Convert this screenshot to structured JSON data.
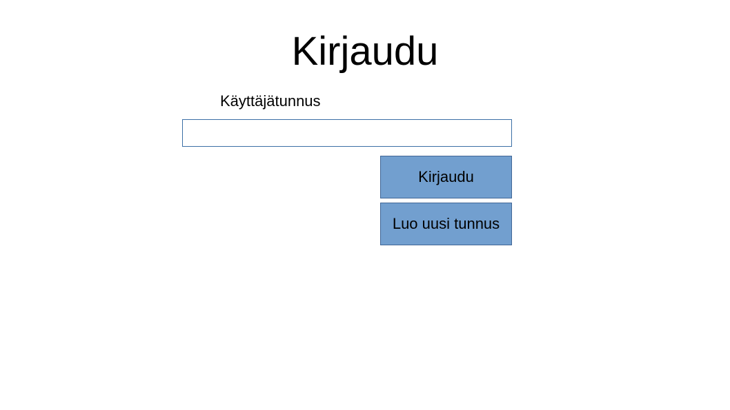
{
  "page": {
    "title": "Kirjaudu"
  },
  "login_form": {
    "username_label": "Käyttäjätunnus",
    "username_value": "",
    "login_button_label": "Kirjaudu",
    "register_button_label": "Luo uusi tunnus"
  },
  "colors": {
    "button_fill": "#729fcf",
    "button_border": "#3f6595",
    "input_border": "#3a6ea5"
  }
}
